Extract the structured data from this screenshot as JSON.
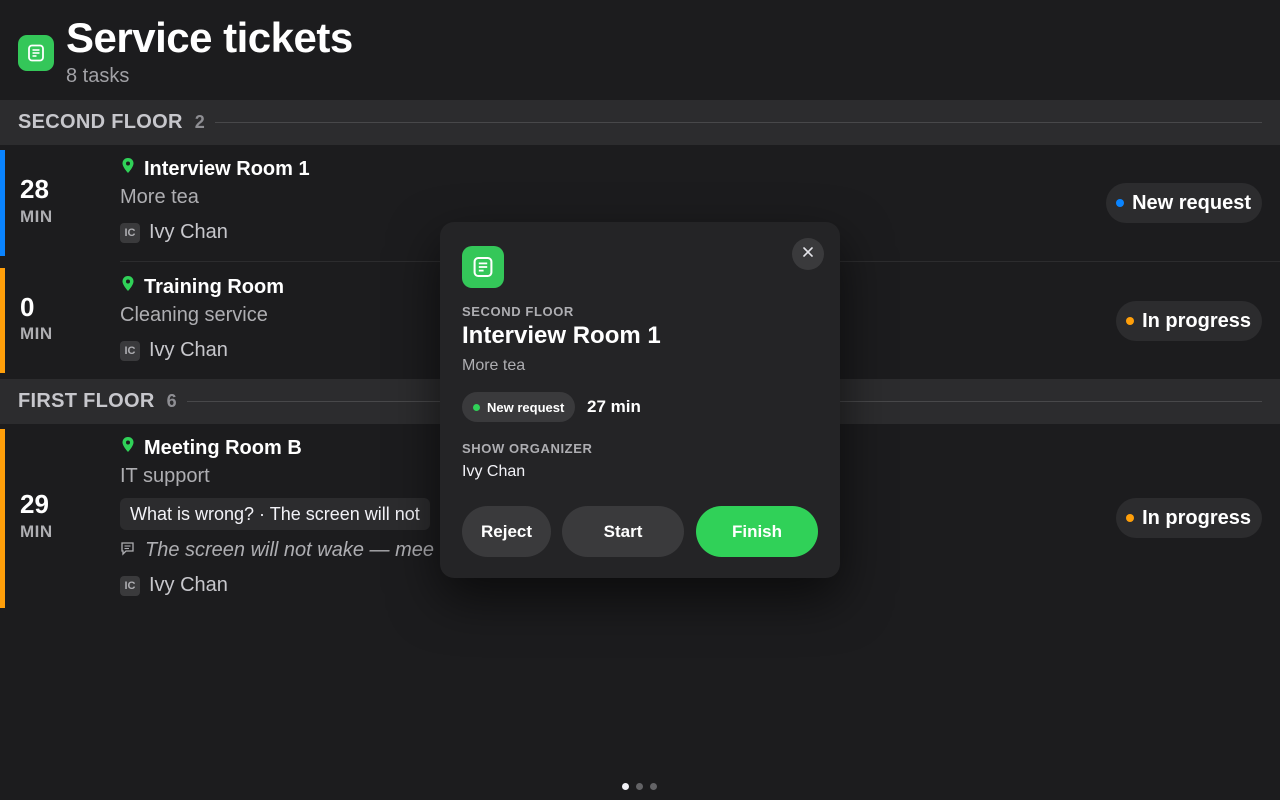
{
  "header": {
    "title": "Service tickets",
    "subtitle": "8 tasks"
  },
  "sections": [
    {
      "title": "SECOND FLOOR",
      "count": "2",
      "tickets": [
        {
          "minutes": "28",
          "unit": "MIN",
          "room": "Interview Room 1",
          "service": "More tea",
          "initials": "IC",
          "person": "Ivy Chan",
          "status": "New request",
          "bar_color": "#0a84ff",
          "dot_color": "#0a84ff"
        },
        {
          "minutes": "0",
          "unit": "MIN",
          "room": "Training Room",
          "service": "Cleaning service",
          "initials": "IC",
          "person": "Ivy Chan",
          "status": "In progress",
          "bar_color": "#ff9f0a",
          "dot_color": "#ff9f0a"
        }
      ]
    },
    {
      "title": "FIRST FLOOR",
      "count": "6",
      "tickets": [
        {
          "minutes": "29",
          "unit": "MIN",
          "room": "Meeting Room B",
          "service": "IT support",
          "question": "What is wrong? · The screen will not",
          "note": "The screen will not wake — mee",
          "initials": "IC",
          "person": "Ivy Chan",
          "status": "In progress",
          "bar_color": "#ff9f0a",
          "dot_color": "#ff9f0a"
        }
      ]
    }
  ],
  "popup": {
    "floor": "SECOND FLOOR",
    "room": "Interview Room 1",
    "service": "More tea",
    "status": "New request",
    "status_dot_color": "#30d158",
    "elapsed": "27 min",
    "organizer_label": "SHOW ORGANIZER",
    "organizer": "Ivy Chan",
    "buttons": {
      "reject": "Reject",
      "start": "Start",
      "finish": "Finish"
    }
  },
  "pager": {
    "pages": 3,
    "active": 1
  },
  "colors": {
    "accent_green": "#34c759",
    "finish_green": "#30d158",
    "new_blue": "#0a84ff",
    "progress_orange": "#ff9f0a"
  },
  "icons": [
    "note-icon",
    "location-pin-icon",
    "comment-icon",
    "close-icon"
  ]
}
